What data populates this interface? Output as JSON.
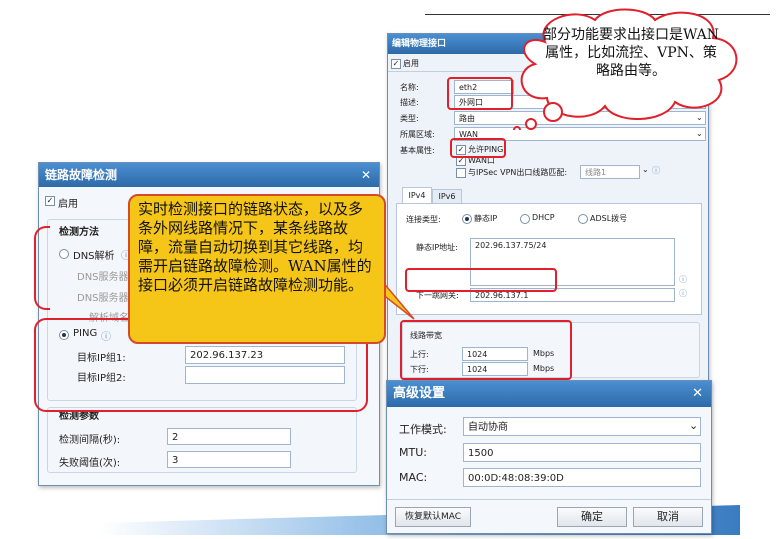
{
  "interface_window": {
    "title": "编辑物理接口",
    "enable_label": "启用",
    "name_label": "名称:",
    "name_value": "eth2",
    "desc_label": "描述:",
    "desc_value": "外网口",
    "type_label": "类型:",
    "type_value": "路由",
    "zone_label": "所属区域:",
    "zone_value": "WAN",
    "basic_label": "基本属性:",
    "ping_label": "允许PING",
    "wan_label": "WAN口",
    "ipsec_label": "与IPSec VPN出口线路匹配:",
    "ipsec_value": "线路1",
    "tab_ipv4": "IPv4",
    "tab_ipv6": "IPv6",
    "conn_type_label": "连接类型:",
    "conn_static": "静态IP",
    "conn_dhcp": "DHCP",
    "conn_adsl": "ADSL拨号",
    "static_ip_label": "静态IP地址:",
    "static_ip_value": "202.96.137.75/24",
    "gateway_label": "下一跳网关:",
    "gateway_value": "202.96.137.1",
    "bandwidth_label": "线路带宽",
    "up_label": "上行:",
    "up_value": "1024",
    "down_label": "下行:",
    "down_value": "1024",
    "unit": "Mbps"
  },
  "fault_window": {
    "title": "链路故障检测",
    "enable_label": "启用",
    "method_title": "检测方法",
    "dns_label": "DNS解析",
    "dns_server1": "DNS服务器",
    "dns_server2": "DNS服务器",
    "resolve_domain": "解析域名:",
    "ping_label": "PING",
    "target1_label": "目标IP组1:",
    "target1_value": "202.96.137.23",
    "target2_label": "目标IP组2:",
    "target2_value": "",
    "params_title": "检测参数",
    "interval_label": "检测间隔(秒):",
    "interval_value": "2",
    "threshold_label": "失败阈值(次):",
    "threshold_value": "3"
  },
  "advanced_window": {
    "title": "高级设置",
    "mode_label": "工作模式:",
    "mode_value": "自动协商",
    "mtu_label": "MTU:",
    "mtu_value": "1500",
    "mac_label": "MAC:",
    "mac_value": "00:0D:48:08:39:0D",
    "restore_btn": "恢复默认MAC",
    "ok_btn": "确定",
    "cancel_btn": "取消"
  },
  "callout_link": "实时检测接口的链路状态，以及多条外网线路情况下，某条线路故障，流量自动切换到其它线路，均需开启链路故障检测。WAN属性的接口必须开启链路故障检测功能。",
  "callout_cloud": "部分功能要求出接口是WAN属性，比如流控、VPN、策略路由等。",
  "colors": {
    "accent": "#2e6aa8",
    "highlight": "#e0202a",
    "note_fill": "#f5c518"
  }
}
